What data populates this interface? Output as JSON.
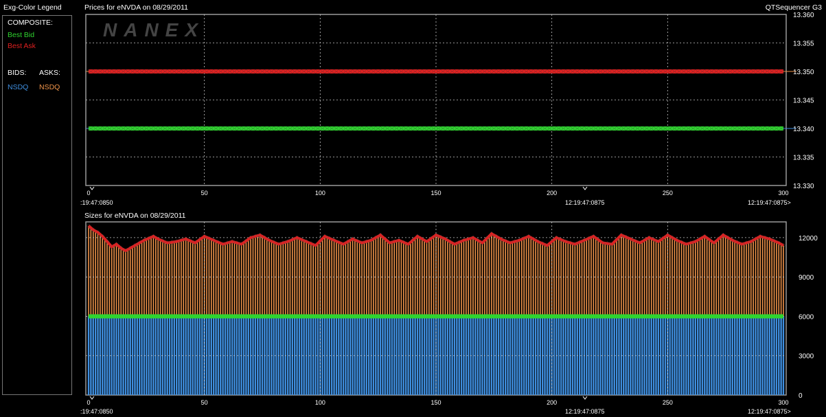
{
  "legend": {
    "title": "Exg-Color Legend",
    "composite_label": "COMPOSITE:",
    "best_bid": "Best Bid",
    "best_ask": "Best Ask",
    "bids_label": "BIDS:",
    "asks_label": "ASKS:",
    "bid_exchange": "NSDQ",
    "ask_exchange": "NSDQ"
  },
  "header": {
    "prices_title": "Prices for  eNVDA  on  08/29/2011",
    "app_name": "QTSequencer G3",
    "sizes_title": "Sizes for  eNVDA  on  08/29/2011",
    "watermark": "NANEX"
  },
  "time_labels": {
    "left": ":19:47:0850",
    "middle": "12:19:47:0875",
    "right": "12:19:47:0875>"
  },
  "colors": {
    "best_bid": "#2fd42f",
    "best_ask": "#e02020",
    "nsdq_bid": "#3f8fe0",
    "nsdq_ask": "#f0944a",
    "grid": "#c8c8c8",
    "plot_border": "#9a9a9a"
  },
  "chart_data": [
    {
      "type": "line",
      "title": "Prices for  eNVDA  on  08/29/2011",
      "xlim": [
        0,
        300
      ],
      "ylim": [
        13.33,
        13.36
      ],
      "x_ticks": [
        0,
        50,
        100,
        150,
        200,
        250,
        300
      ],
      "y_ticks": [
        "13.330",
        "13.335",
        "13.340",
        "13.345",
        "13.350",
        "13.355",
        "13.360"
      ],
      "grid": true,
      "series": [
        {
          "name": "Best Ask",
          "x_range": [
            0,
            300
          ],
          "value": 13.35
        },
        {
          "name": "Best Bid",
          "x_range": [
            0,
            300
          ],
          "value": 13.34
        }
      ]
    },
    {
      "type": "bar",
      "title": "Sizes for  eNVDA  on  08/29/2011",
      "xlim": [
        0,
        300
      ],
      "ylim": [
        0,
        13200
      ],
      "x_ticks": [
        0,
        50,
        100,
        150,
        200,
        250,
        300
      ],
      "y_ticks": [
        "0",
        "3000",
        "6000",
        "9000",
        "12000"
      ],
      "grid": true,
      "series": [
        {
          "name": "Best Bid",
          "value": 6000
        },
        {
          "name": "Best Ask",
          "pattern_x": [
            0,
            2,
            4,
            6,
            8,
            10,
            12,
            14,
            16,
            18,
            20,
            24,
            28,
            30,
            34,
            38,
            42,
            46,
            50,
            54,
            58,
            62,
            66,
            70,
            74,
            78,
            82,
            86,
            90,
            94,
            98,
            102,
            106,
            110,
            114,
            118,
            122,
            126,
            130,
            134,
            138,
            142,
            146,
            150,
            154,
            158,
            162,
            166,
            170,
            174,
            178,
            182,
            186,
            190,
            194,
            198,
            202,
            206,
            210,
            214,
            218,
            222,
            226,
            230,
            234,
            238,
            242,
            246,
            250,
            254,
            258,
            262,
            266,
            270,
            274,
            278,
            282,
            286,
            290,
            294,
            298,
            300
          ],
          "values": [
            12900,
            12600,
            12400,
            12100,
            11700,
            11300,
            11500,
            11200,
            11000,
            11200,
            11400,
            11800,
            12100,
            11900,
            11600,
            11700,
            11900,
            11600,
            12100,
            11800,
            11500,
            11700,
            11500,
            12000,
            12200,
            11800,
            11500,
            11700,
            12000,
            11700,
            11400,
            12100,
            11800,
            11500,
            11900,
            11600,
            11800,
            12200,
            11600,
            11800,
            11500,
            12100,
            11700,
            12200,
            11900,
            11500,
            11800,
            12000,
            11600,
            12300,
            11900,
            11600,
            11800,
            12100,
            11700,
            11400,
            12000,
            11700,
            11500,
            11800,
            12100,
            11600,
            11500,
            12200,
            11900,
            11600,
            12000,
            11700,
            12200,
            11800,
            11500,
            11700,
            12100,
            11600,
            12200,
            11800,
            11500,
            11700,
            12100,
            11900,
            11600,
            11400
          ]
        }
      ]
    }
  ]
}
